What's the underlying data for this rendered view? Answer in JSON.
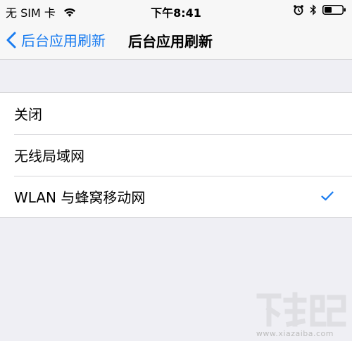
{
  "status_bar": {
    "carrier": "无 SIM 卡",
    "time": "下午8:41",
    "icons": [
      "wifi-icon",
      "alarm-icon",
      "bluetooth-icon",
      "battery-icon"
    ]
  },
  "nav": {
    "back_label": "后台应用刷新",
    "title": "后台应用刷新"
  },
  "options": [
    {
      "label": "关闭",
      "selected": false
    },
    {
      "label": "无线局域网",
      "selected": false
    },
    {
      "label": "WLAN 与蜂窝移动网",
      "selected": true
    }
  ],
  "watermark": {
    "text": "www.xiazaiba.com"
  },
  "colors": {
    "accent": "#1a7cf0",
    "background": "#efeff4",
    "bar": "#f7f7f7"
  }
}
